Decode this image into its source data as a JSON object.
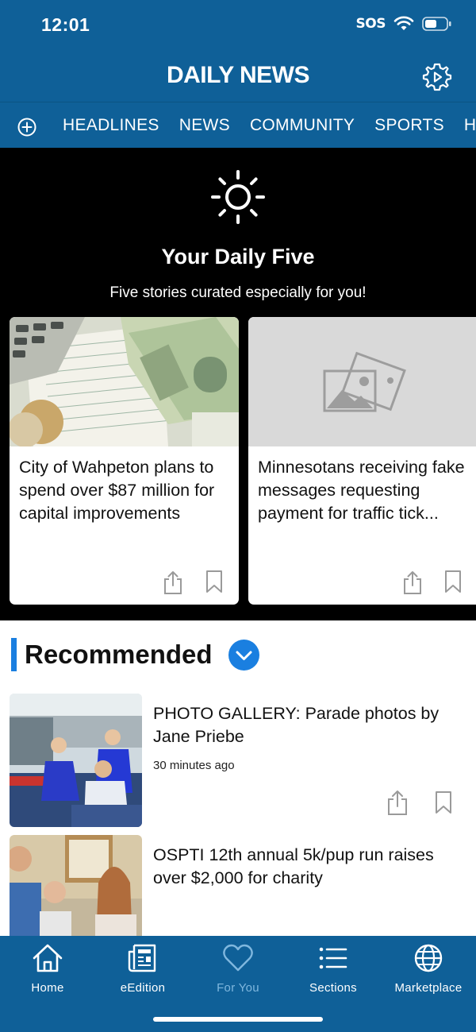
{
  "status_bar": {
    "time": "12:01",
    "sos": "SOS",
    "wifi_icon": "wifi-icon",
    "battery_icon": "battery-icon"
  },
  "header": {
    "title": "DAILY NEWS",
    "settings_icon": "gear-icon"
  },
  "tabs": {
    "add_icon": "plus-circle-icon",
    "items": [
      {
        "label": "HEADLINES"
      },
      {
        "label": "NEWS"
      },
      {
        "label": "COMMUNITY"
      },
      {
        "label": "SPORTS"
      },
      {
        "label": "HUM"
      }
    ]
  },
  "daily_five": {
    "icon": "sun-icon",
    "title": "Your Daily Five",
    "subtitle": "Five stories curated especially for you!",
    "cards": [
      {
        "headline": "City of Wahpeton plans to spend over $87 million for capital improvements",
        "image": "photo-money-calculator"
      },
      {
        "headline": "Minnesotans receiving fake messages requesting payment for traffic tick...",
        "image": "image-placeholder-icon"
      }
    ]
  },
  "recommended": {
    "title": "Recommended",
    "toggle_icon": "chevron-down-icon",
    "stories": [
      {
        "headline": "PHOTO GALLERY: Parade photos by Jane Priebe",
        "time": "30 minutes ago",
        "image": "photo-parade-kids"
      },
      {
        "headline": "OSPTI 12th annual 5k/pup run raises over $2,000 for charity",
        "time": "",
        "image": "photo-group-office"
      }
    ]
  },
  "bottom_nav": {
    "items": [
      {
        "label": "Home",
        "icon": "home-icon",
        "active": false
      },
      {
        "label": "eEdition",
        "icon": "newspaper-icon",
        "active": false
      },
      {
        "label": "For You",
        "icon": "heart-icon",
        "active": true
      },
      {
        "label": "Sections",
        "icon": "list-icon",
        "active": false
      },
      {
        "label": "Marketplace",
        "icon": "globe-icon",
        "active": false
      }
    ]
  },
  "colors": {
    "brand_blue": "#0f6098",
    "accent_blue": "#1a7fe0",
    "active_nav": "#7fb7de"
  }
}
